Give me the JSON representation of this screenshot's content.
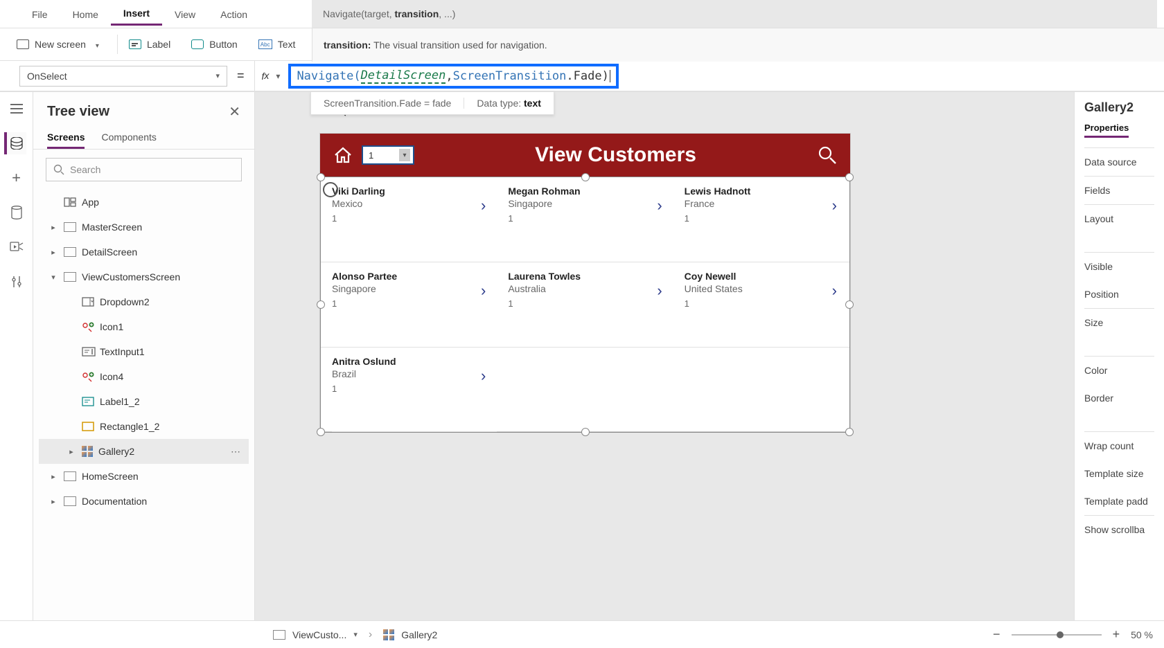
{
  "ribbon": {
    "tabs": [
      "File",
      "Home",
      "Insert",
      "View",
      "Action"
    ],
    "activeTab": "Insert",
    "signature_prefix": "Navigate(target, ",
    "signature_bold": "transition",
    "signature_suffix": ", ...)"
  },
  "subRibbon": {
    "newScreen": "New screen",
    "label": "Label",
    "button": "Button",
    "text": "Text",
    "tooltip_label": "transition:",
    "tooltip_text": "The visual transition used for navigation."
  },
  "formulaBar": {
    "property": "OnSelect",
    "fx": "fx",
    "fn_open": "Navigate(",
    "arg": "DetailScreen",
    "comma": ", ",
    "transition_obj": "ScreenTransition",
    "dot": ".",
    "transition_enum": "Fade",
    "close": ")"
  },
  "resultBar": {
    "left": "ScreenTransition.Fade  =  fade",
    "right_label": "Data type: ",
    "right_value": "text"
  },
  "treeView": {
    "title": "Tree view",
    "tabs": [
      "Screens",
      "Components"
    ],
    "activeTab": "Screens",
    "searchPlaceholder": "Search",
    "app": "App",
    "items": [
      {
        "label": "MasterScreen"
      },
      {
        "label": "DetailScreen"
      },
      {
        "label": "ViewCustomersScreen",
        "expanded": true,
        "children": [
          {
            "label": "Dropdown2",
            "kind": "dropdown"
          },
          {
            "label": "Icon1",
            "kind": "iconadd"
          },
          {
            "label": "TextInput1",
            "kind": "textinput"
          },
          {
            "label": "Icon4",
            "kind": "iconadd"
          },
          {
            "label": "Label1_2",
            "kind": "label"
          },
          {
            "label": "Rectangle1_2",
            "kind": "rect"
          },
          {
            "label": "Gallery2",
            "kind": "gallery",
            "selected": true
          }
        ]
      },
      {
        "label": "HomeScreen"
      },
      {
        "label": "Documentation"
      }
    ]
  },
  "canvas": {
    "title": "View Customers",
    "dropdownValue": "1",
    "customers": [
      {
        "name": "Viki  Darling",
        "country": "Mexico",
        "num": "1"
      },
      {
        "name": "Megan  Rohman",
        "country": "Singapore",
        "num": "1"
      },
      {
        "name": "Lewis  Hadnott",
        "country": "France",
        "num": "1"
      },
      {
        "name": "Alonso  Partee",
        "country": "Singapore",
        "num": "1"
      },
      {
        "name": "Laurena  Towles",
        "country": "Australia",
        "num": "1"
      },
      {
        "name": "Coy  Newell",
        "country": "United States",
        "num": "1"
      },
      {
        "name": "Anitra  Oslund",
        "country": "Brazil",
        "num": "1"
      }
    ]
  },
  "props": {
    "title": "Gallery2",
    "tab": "Properties",
    "rows": [
      "Data source",
      "Fields",
      "Layout",
      "Visible",
      "Position",
      "Size",
      "Color",
      "Border",
      "Wrap count",
      "Template size",
      "Template padd",
      "Show scrollba"
    ]
  },
  "bottom": {
    "screen": "ViewCusto...",
    "control": "Gallery2",
    "zoom": "50 %"
  }
}
